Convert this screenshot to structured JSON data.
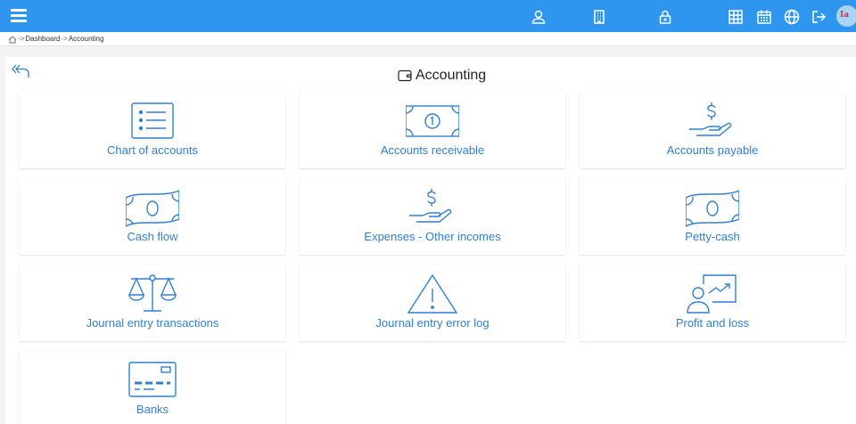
{
  "topbar": {
    "icons": [
      "menu-icon",
      "user-icon",
      "building-icon",
      "lock-icon",
      "grid-icon",
      "calendar-icon",
      "globe-icon",
      "logout-icon",
      "logo"
    ],
    "bg_color": "#2f96f0"
  },
  "breadcrumb": {
    "home_icon": "home-icon",
    "items": [
      "Dashboard",
      "Accounting"
    ],
    "separator": "->"
  },
  "page": {
    "title": "Accounting",
    "title_icon": "wallet-icon",
    "back_icon": "back-arrow-icon"
  },
  "tiles": [
    {
      "label": "Chart of accounts",
      "icon": "list-icon"
    },
    {
      "label": "Accounts receivable",
      "icon": "banknote-coin-icon"
    },
    {
      "label": "Accounts payable",
      "icon": "hand-dollar-icon"
    },
    {
      "label": "Cash flow",
      "icon": "banknote-icon"
    },
    {
      "label": "Expenses - Other incomes",
      "icon": "hand-dollar-icon"
    },
    {
      "label": "Petty-cash",
      "icon": "banknote-icon"
    },
    {
      "label": "Journal entry transactions",
      "icon": "scales-icon"
    },
    {
      "label": "Journal entry error log",
      "icon": "warning-triangle-icon"
    },
    {
      "label": "Profit and loss",
      "icon": "presentation-chart-icon"
    },
    {
      "label": "Banks",
      "icon": "credit-card-icon"
    }
  ],
  "colors": {
    "accent": "#2f96f0",
    "tile_text": "#2f7fd6"
  }
}
